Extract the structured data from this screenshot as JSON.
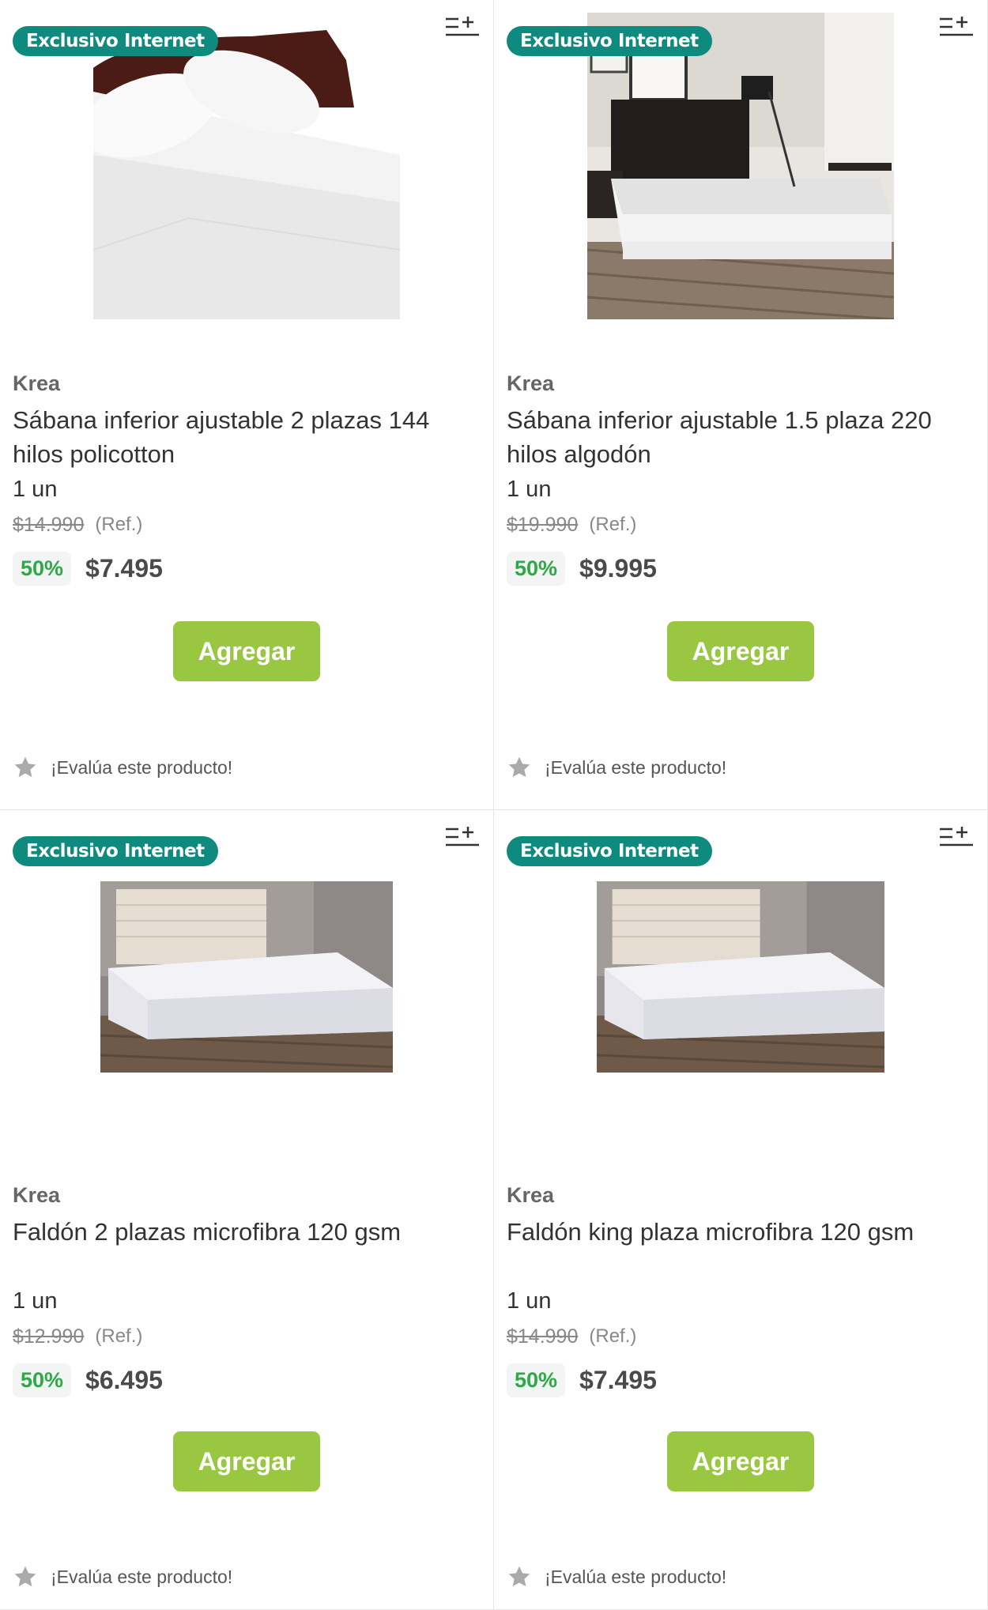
{
  "products": [
    {
      "badge": "Exclusivo Internet",
      "brand": "Krea",
      "name": "Sábana inferior ajustable 2 plazas 144 hilos policotton",
      "quantity": "1 un",
      "ref_price": "$14.990",
      "ref_label": "(Ref.)",
      "discount": "50%",
      "price": "$7.495",
      "add_label": "Agregar",
      "rating_label": "¡Evalúa este producto!",
      "image_icon": "white-sheets-photo"
    },
    {
      "badge": "Exclusivo Internet",
      "brand": "Krea",
      "name": "Sábana inferior ajustable 1.5 plaza 220 hilos algodón",
      "quantity": "1 un",
      "ref_price": "$19.990",
      "ref_label": "(Ref.)",
      "discount": "50%",
      "price": "$9.995",
      "add_label": "Agregar",
      "rating_label": "¡Evalúa este producto!",
      "image_icon": "bedroom-bed-photo"
    },
    {
      "badge": "Exclusivo Internet",
      "brand": "Krea",
      "name": "Faldón 2 plazas microfibra 120 gsm",
      "quantity": "1 un",
      "ref_price": "$12.990",
      "ref_label": "(Ref.)",
      "discount": "50%",
      "price": "$6.495",
      "add_label": "Agregar",
      "rating_label": "¡Evalúa este producto!",
      "image_icon": "bed-skirt-photo"
    },
    {
      "badge": "Exclusivo Internet",
      "brand": "Krea",
      "name": "Faldón king plaza microfibra 120 gsm",
      "quantity": "1 un",
      "ref_price": "$14.990",
      "ref_label": "(Ref.)",
      "discount": "50%",
      "price": "$7.495",
      "add_label": "Agregar",
      "rating_label": "¡Evalúa este producto!",
      "image_icon": "bed-skirt-photo"
    }
  ],
  "colors": {
    "badge": "#0f8a7e",
    "add_button": "#99c742",
    "discount_text": "#2fa847",
    "price": "#4a4a4a"
  },
  "icons": {
    "list_add": "add-to-list-icon",
    "star": "star-icon"
  }
}
